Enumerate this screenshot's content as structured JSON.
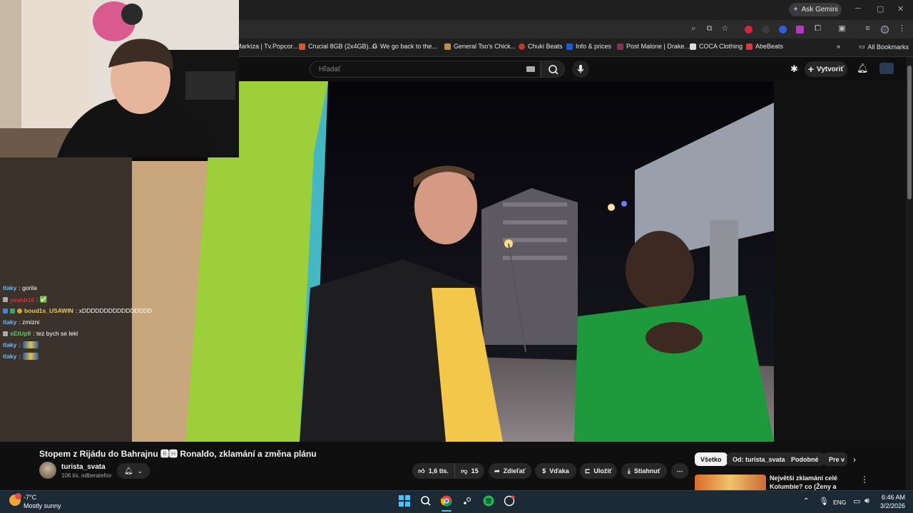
{
  "browser": {
    "ask_gemini": "Ask Gemini",
    "bookmarks": [
      {
        "label": "Markíza | Tv.Popcor...",
        "color": "#6e6e6e"
      },
      {
        "label": "Crucial 8GB (2x4GB)...",
        "color": "#e0542b"
      },
      {
        "label": "We go back to the...",
        "color": "#4285f4"
      },
      {
        "label": "General Tso's Chick...",
        "color": "#c88b3a"
      },
      {
        "label": "Chuki Beats",
        "color": "#c0392b"
      },
      {
        "label": "Info & prices",
        "color": "#1e5ad6"
      },
      {
        "label": "Post Malone | Drake...",
        "color": "#8e2c5a"
      },
      {
        "label": "COCA Clothing",
        "color": "#dddddd"
      },
      {
        "label": "AbeBeats",
        "color": "#d93b3b"
      }
    ],
    "all_bookmarks": "All Bookmarks"
  },
  "youtube": {
    "search_placeholder": "Hľadať",
    "create_label": "Vytvoriť",
    "video_title": "Stopem z Rijádu do Bahrajnu 🅱🅷 Ronaldo, zklamání a změna plánu",
    "channel_name": "turista_svata",
    "channel_subs": "106 tis. odberateľov",
    "likes": "1,6 tis.",
    "dislikes": "15",
    "share": "Zdieľať",
    "thanks": "Vďaka",
    "save": "Uložiť",
    "download": "Stiahnuť",
    "chips": [
      "Všetko",
      "Od: turista_svata",
      "Podobné",
      "Pre v"
    ],
    "rec_title_1": "Největší zklamání celé",
    "rec_title_2": "Kolumbie? co (Ženy a Krádeže)"
  },
  "chat": {
    "lines": [
      {
        "user": "tlaky",
        "color": "#6fb7ff",
        "msg": ": gorila"
      },
      {
        "user": "yeahh16",
        "color": "#d43535",
        "msg": ": ✅"
      },
      {
        "user": "boud1s_USAWIN",
        "color": "#f2c94c",
        "msg": ": xDDDDDDDDDDDDDDDD"
      },
      {
        "user": "tlaky",
        "color": "#6fb7ff",
        "msg": ": zmizni"
      },
      {
        "user": "sEtUp9",
        "color": "#5ec76b",
        "msg": ": tez bych se lekl"
      },
      {
        "user": "tlaky",
        "color": "#6fb7ff",
        "msg": ":"
      },
      {
        "user": "tlaky",
        "color": "#6fb7ff",
        "msg": ":"
      }
    ]
  },
  "taskbar": {
    "temp": "-7°C",
    "weather": "Mostly sunny",
    "lang": "ENG",
    "time": "6:46 AM",
    "date": "3/2/2026"
  }
}
